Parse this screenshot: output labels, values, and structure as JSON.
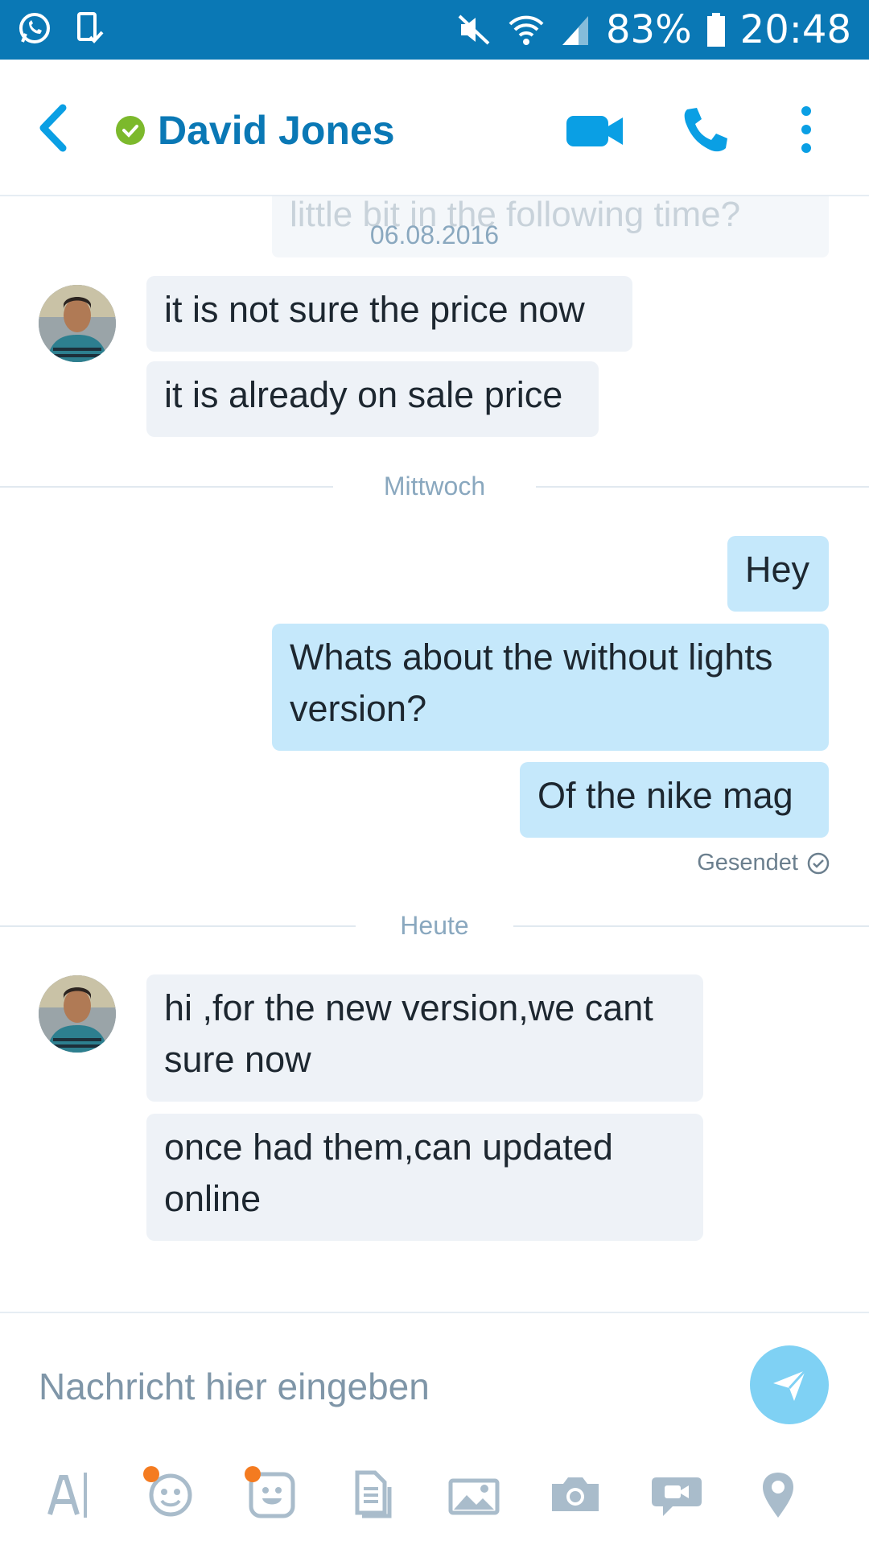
{
  "status_bar": {
    "battery": "83%",
    "time": "20:48",
    "icons": [
      "whatsapp-icon",
      "device-check-icon",
      "mute-icon",
      "wifi-icon",
      "signal-icon",
      "battery-icon"
    ],
    "bg_color": "#0a78b5"
  },
  "header": {
    "contact_name": "David Jones",
    "presence": "online",
    "accent_color": "#0a78b5",
    "presence_color": "#7cb92c",
    "icons": [
      "back-arrow-icon",
      "video-call-icon",
      "phone-icon",
      "more-vertical-icon"
    ]
  },
  "chat": {
    "faded_previous_message": "little bit in the following time?",
    "groups": [
      {
        "date": "06.08.2016",
        "messages": [
          {
            "direction": "in",
            "text": "it is not sure the price now"
          },
          {
            "direction": "in",
            "text": "it is already on sale price"
          }
        ]
      },
      {
        "date": "Mittwoch",
        "messages": [
          {
            "direction": "out",
            "text": "Hey"
          },
          {
            "direction": "out",
            "text": "Whats about the without lights version?"
          },
          {
            "direction": "out",
            "text": "Of the nike mag"
          }
        ],
        "status": "Gesendet"
      },
      {
        "date": "Heute",
        "messages": [
          {
            "direction": "in",
            "text": "hi ,for the new version,we cant sure now"
          },
          {
            "direction": "in",
            "text": "once had them,can updated online"
          }
        ]
      }
    ],
    "incoming_bubble_color": "#eef2f7",
    "outgoing_bubble_color": "#c5e8fb"
  },
  "compose": {
    "placeholder": "Nachricht hier eingeben",
    "send_color": "#7fd1f4",
    "tools": [
      "text-format-icon",
      "emoticon-icon",
      "moji-icon",
      "file-icon",
      "media-icon",
      "camera-icon",
      "video-message-icon",
      "location-icon"
    ]
  }
}
